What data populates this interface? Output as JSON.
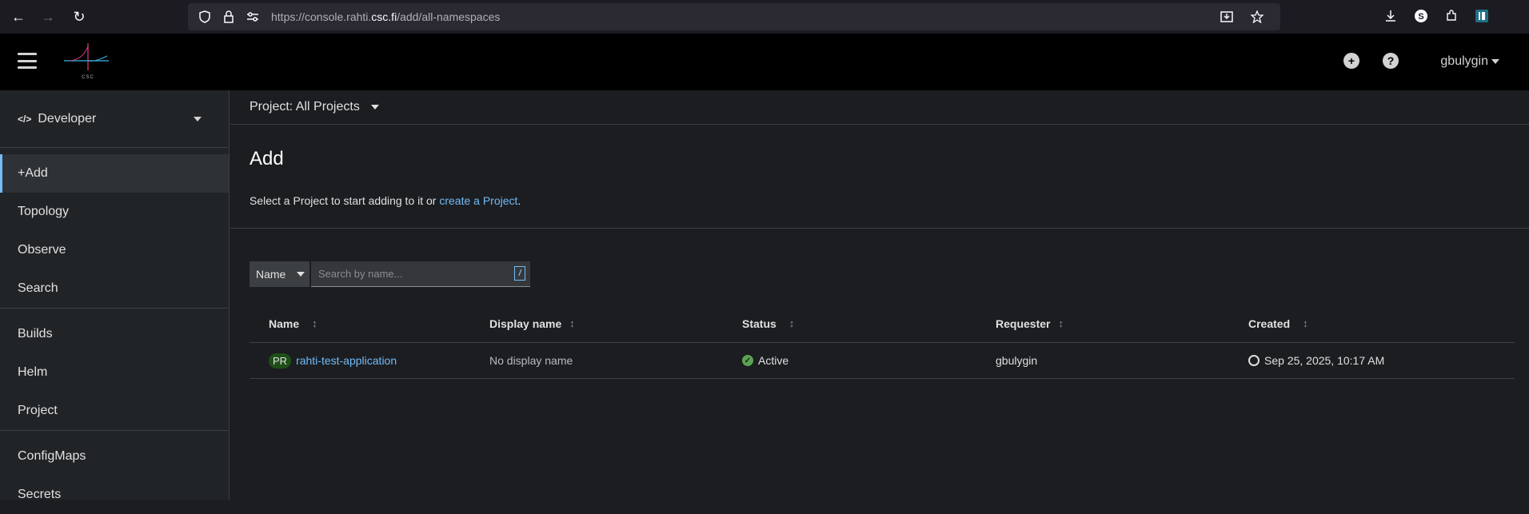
{
  "browser": {
    "url_prefix": "https://console.rahti.",
    "url_domain": "csc.fi",
    "url_path": "/add/all-namespaces"
  },
  "masthead": {
    "logo_text": "CSC",
    "user": "gbulygin"
  },
  "sidebar": {
    "perspective": "Developer",
    "groups": [
      [
        "+Add",
        "Topology",
        "Observe",
        "Search"
      ],
      [
        "Builds",
        "Helm",
        "Project"
      ],
      [
        "ConfigMaps",
        "Secrets"
      ]
    ]
  },
  "main": {
    "project_selector": "Project: All Projects",
    "title": "Add",
    "description_prefix": "Select a Project to start adding to it or ",
    "description_link": "create a Project",
    "description_suffix": ".",
    "filter": {
      "select": "Name",
      "placeholder": "Search by name...",
      "shortcut": "/"
    },
    "table": {
      "headers": [
        "Name",
        "Display name",
        "Status",
        "Requester",
        "Created"
      ],
      "rows": [
        {
          "badge": "PR",
          "name": "rahti-test-application",
          "display_name": "No display name",
          "status": "Active",
          "requester": "gbulygin",
          "created": "Sep 25, 2025, 10:17 AM"
        }
      ]
    }
  }
}
